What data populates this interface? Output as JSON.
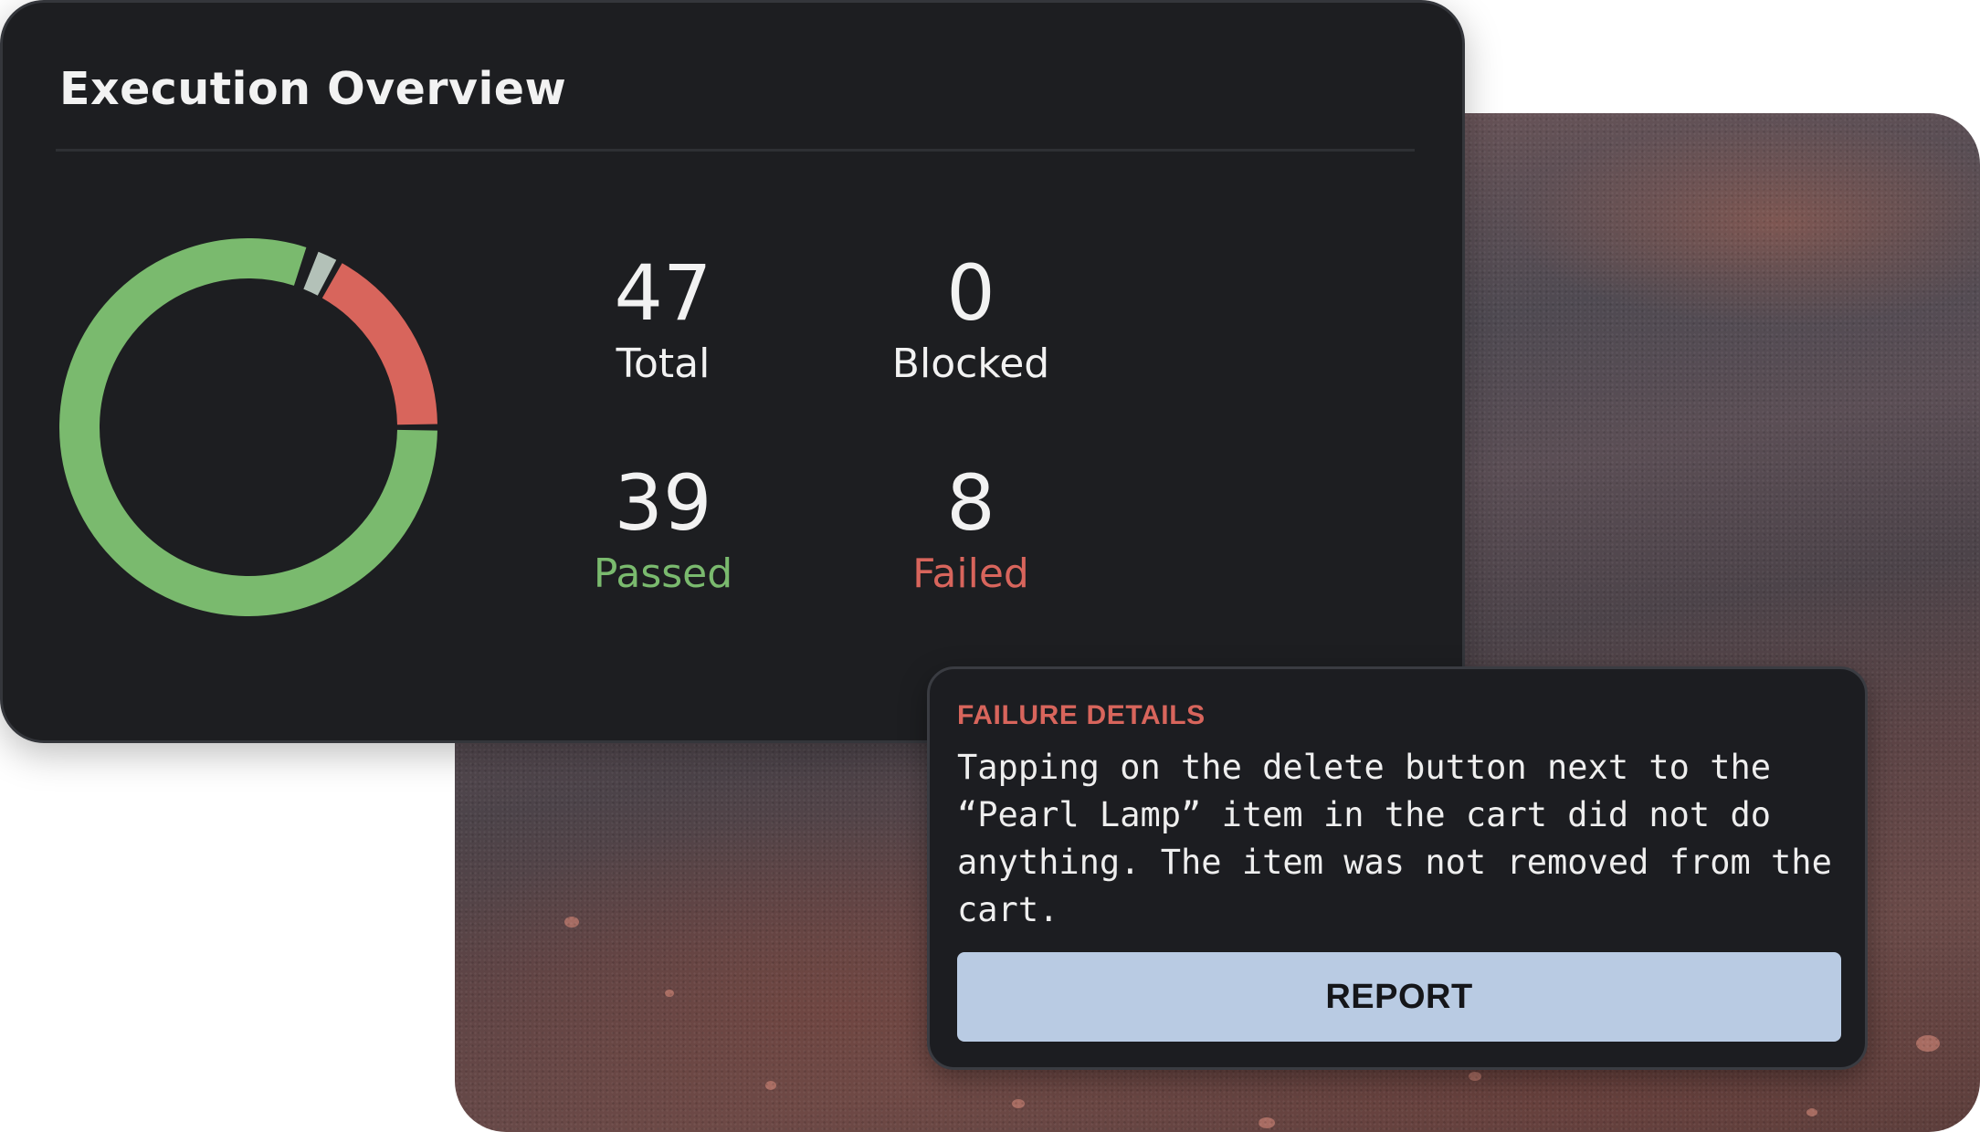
{
  "overview": {
    "title": "Execution Overview",
    "stats": {
      "total": {
        "value": "47",
        "label": "Total"
      },
      "blocked": {
        "value": "0",
        "label": "Blocked"
      },
      "passed": {
        "value": "39",
        "label": "Passed"
      },
      "failed": {
        "value": "8",
        "label": "Failed"
      }
    },
    "donut": {
      "segments": [
        {
          "name": "passed",
          "count": 39,
          "color": "#7aba6e"
        },
        {
          "name": "blocked",
          "count": 0,
          "color": "#b3c1b8"
        },
        {
          "name": "failed",
          "count": 8,
          "color": "#d8655c"
        }
      ]
    },
    "colors": {
      "passed": "#7aba6e",
      "failed": "#d8655c",
      "blocked_marker": "#b3c1b8"
    }
  },
  "failure": {
    "heading": "FAILURE DETAILS",
    "description": "Tapping on the delete button next to the “Pearl Lamp” item in the cart did not do anything. The item was not removed from the cart.",
    "report_label": "REPORT",
    "accent": "#d8655c",
    "button_color": "#b9cbe3"
  }
}
